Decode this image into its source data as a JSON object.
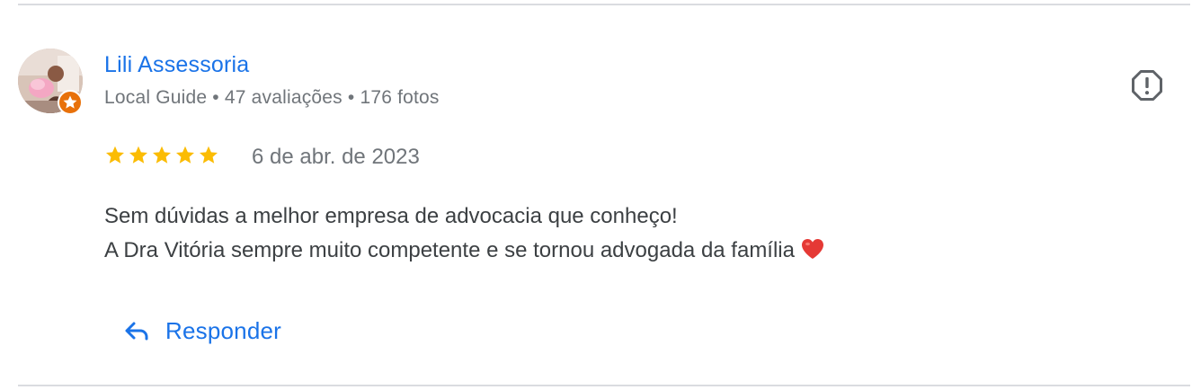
{
  "review": {
    "reviewer": {
      "name": "Lili Assessoria",
      "badge": "Local Guide",
      "reviews_count": "47 avaliações",
      "photos_count": "176 fotos",
      "separator": "•",
      "avatar_icon": "profile-photo",
      "badge_icon": "local-guide-star-icon"
    },
    "rating": 5,
    "date": "6 de abr. de 2023",
    "text_lines": [
      "Sem dúvidas a melhor empresa de advocacia que conheço!",
      "A Dra Vitória sempre muito competente e se tornou advogada da família"
    ],
    "trailing_emoji": "heart-icon",
    "report_icon": "report-icon",
    "reply": {
      "icon": "reply-arrow-icon",
      "label": "Responder"
    }
  },
  "colors": {
    "accent": "#1a73e8",
    "star": "#fbbc04",
    "secondary_text": "#70757a",
    "body_text": "#3c4043",
    "guide_badge": "#e8710a",
    "divider": "#dadce0",
    "heart": "#e53935"
  }
}
